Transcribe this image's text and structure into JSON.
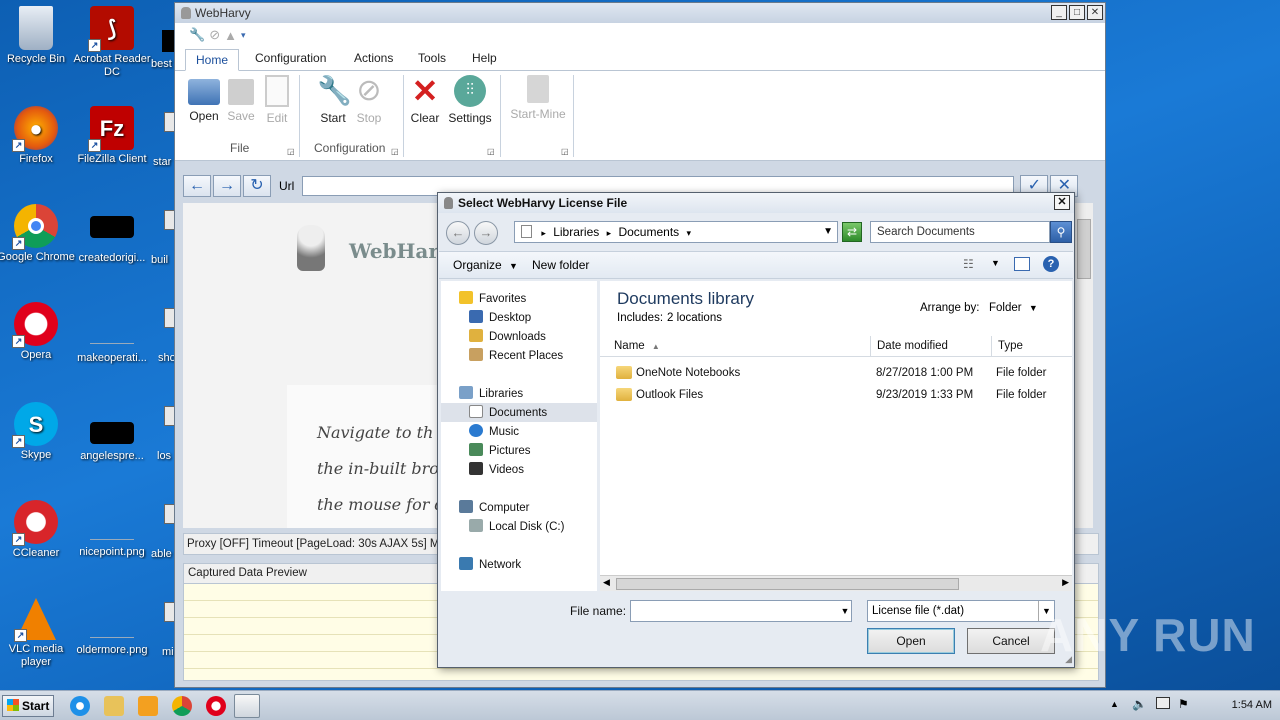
{
  "desktop_icons": [
    {
      "label": "Recycle Bin",
      "icon": "recycle-bin-icon"
    },
    {
      "label": "Acrobat Reader DC",
      "icon": "acrobat-icon"
    },
    {
      "label": "Firefox",
      "icon": "firefox-icon"
    },
    {
      "label": "FileZilla Client",
      "icon": "filezilla-icon"
    },
    {
      "label": "Google Chrome",
      "icon": "chrome-icon"
    },
    {
      "label": "createdorigi...",
      "icon": "file-icon"
    },
    {
      "label": "Opera",
      "icon": "opera-icon"
    },
    {
      "label": "makeoperati...",
      "icon": "file-icon"
    },
    {
      "label": "Skype",
      "icon": "skype-icon"
    },
    {
      "label": "angelespre...",
      "icon": "file-icon"
    },
    {
      "label": "CCleaner",
      "icon": "ccleaner-icon"
    },
    {
      "label": "nicepoint.png",
      "icon": "file-icon"
    },
    {
      "label": "VLC media player",
      "icon": "vlc-icon"
    },
    {
      "label": "oldermore.png",
      "icon": "file-icon"
    }
  ],
  "desktop_partial": [
    "best",
    "star",
    "buil",
    "sho",
    "los",
    "able",
    "mi"
  ],
  "webharvy": {
    "title": "WebHarvy",
    "tabs": [
      "Home",
      "Configuration",
      "Actions",
      "Tools",
      "Help"
    ],
    "ribbon": {
      "open": "Open",
      "save": "Save",
      "edit": "Edit",
      "start": "Start",
      "stop": "Stop",
      "clear": "Clear",
      "settings": "Settings",
      "startmine": "Start-Mine",
      "group_file": "File",
      "group_config": "Configuration"
    },
    "url_label": "Url",
    "url_value": "",
    "brand": "WebHarv",
    "hint_lines": [
      "Navigate to th",
      "the in-built bro",
      "the mouse for d"
    ],
    "status": "Proxy [OFF] Timeout [PageLoad: 30s AJAX 5s] Mine",
    "captured_preview": "Captured Data Preview"
  },
  "dialog": {
    "title": "Select WebHarvy License File",
    "breadcrumb": [
      "Libraries",
      "Documents"
    ],
    "search_placeholder": "Search Documents",
    "organize": "Organize",
    "new_folder": "New folder",
    "nav": {
      "favorites": "Favorites",
      "desktop": "Desktop",
      "downloads": "Downloads",
      "recent": "Recent Places",
      "libraries": "Libraries",
      "documents": "Documents",
      "music": "Music",
      "pictures": "Pictures",
      "videos": "Videos",
      "computer": "Computer",
      "local_disk": "Local Disk (C:)",
      "network": "Network"
    },
    "library_title": "Documents library",
    "includes_label": "Includes:",
    "includes_link": "2 locations",
    "arrange_by": "Arrange by:",
    "arrange_value": "Folder",
    "columns": [
      "Name",
      "Date modified",
      "Type"
    ],
    "files": [
      {
        "name": "OneNote Notebooks",
        "date": "8/27/2018 1:00 PM",
        "type": "File folder"
      },
      {
        "name": "Outlook Files",
        "date": "9/23/2019 1:33 PM",
        "type": "File folder"
      }
    ],
    "file_name_label": "File name:",
    "file_name_value": "",
    "file_type": "License file (*.dat)",
    "open": "Open",
    "cancel": "Cancel"
  },
  "taskbar": {
    "start": "Start",
    "time": "1:54 AM"
  },
  "watermark": "ANY RUN"
}
